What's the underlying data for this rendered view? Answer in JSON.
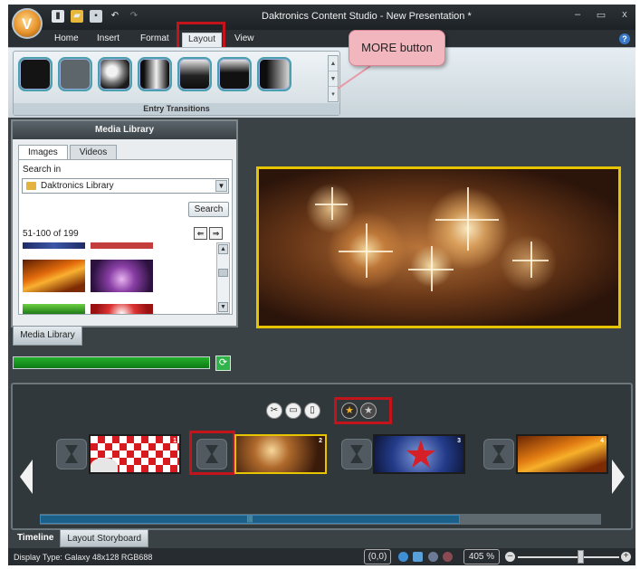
{
  "window": {
    "title": "Daktronics Content Studio - New Presentation *"
  },
  "app_menu": {
    "letter": "V"
  },
  "ribbon_tabs": [
    "Home",
    "Insert",
    "Format",
    "Layout",
    "View"
  ],
  "active_ribbon_tab": "Layout",
  "ribbon_group": {
    "label": "Entry Transitions"
  },
  "callout": {
    "text": "MORE button"
  },
  "media_library": {
    "title": "Media Library",
    "tabs": [
      "Images",
      "Videos"
    ],
    "active_tab": "Images",
    "search_in_label": "Search in",
    "library_value": "Daktronics Library",
    "search_button": "Search",
    "range": "51-100 of 199"
  },
  "media_library_tab": "Media Library",
  "progress_fraction": 1.0,
  "timeline": {
    "slide_numbers": [
      "1",
      "2",
      "3",
      "4"
    ],
    "selected_slide": "2"
  },
  "bottom_tabs": [
    "Timeline",
    "Layout Storyboard"
  ],
  "active_bottom_tab": "Timeline",
  "status": {
    "display_type": "Display Type:  Galaxy 48x128 RGB688",
    "coordinates": "(0,0)",
    "zoom": "405 %"
  },
  "colors": {
    "highlight": "#c4141b",
    "selection": "#e6c400",
    "progress": "#1b9a23"
  },
  "icons": {
    "cut": "scissors-icon",
    "copy": "copy-icon",
    "paste": "paste-icon",
    "add_star": "star-add-icon",
    "remove_star": "star-remove-icon"
  }
}
